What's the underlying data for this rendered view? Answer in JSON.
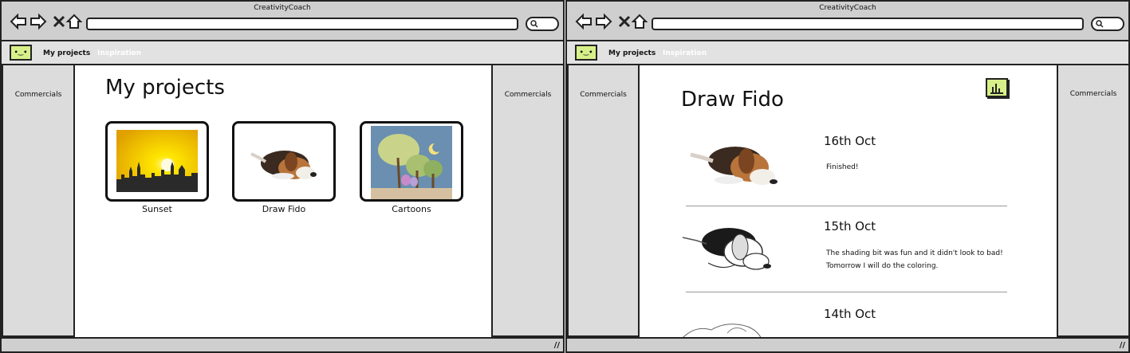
{
  "left_window": {
    "title": "CreativityCoach",
    "menu": {
      "my_projects": "My projects",
      "inspiration": "Inspiration"
    },
    "logo_text": "•‿•",
    "sidebar_left": "Commercials",
    "sidebar_right": "Commercials",
    "page_title": "My projects",
    "projects": [
      {
        "label": "Sunset",
        "thumb": "sunset-thumbnail"
      },
      {
        "label": "Draw Fido",
        "thumb": "dog-thumbnail"
      },
      {
        "label": "Cartoons",
        "thumb": "cartoon-thumbnail"
      }
    ]
  },
  "right_window": {
    "title": "CreativityCoach",
    "menu": {
      "my_projects": "My projects",
      "inspiration": "Inspiration"
    },
    "logo_text": "•‿•",
    "sidebar_left": "Commercials",
    "sidebar_right": "Commercials",
    "page_title": "Draw Fido",
    "entries": [
      {
        "date": "16th Oct",
        "note_line1": "Finished!",
        "note_line2": ""
      },
      {
        "date": "15th Oct",
        "note_line1": "The shading bit was fun and it didn't look to bad!",
        "note_line2": "Tomorrow I will do the coloring."
      },
      {
        "date": "14th Oct",
        "note_line1": "",
        "note_line2": ""
      }
    ]
  },
  "colors": {
    "chrome": "#cfcfcf",
    "sidebar": "#dcdcdc",
    "accent": "#d8f08a"
  },
  "icons": [
    "back-arrow-icon",
    "forward-arrow-icon",
    "close-icon",
    "home-icon",
    "search-icon",
    "resize-grip-icon",
    "chart-icon"
  ]
}
